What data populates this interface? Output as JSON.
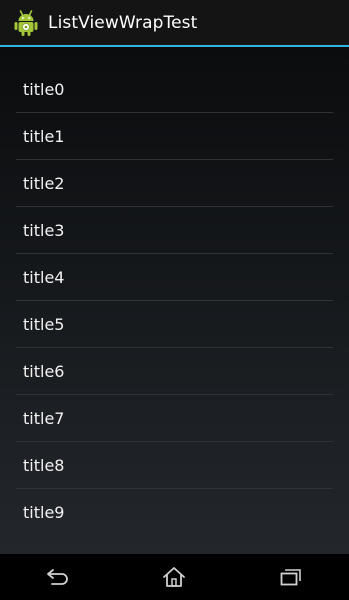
{
  "action_bar": {
    "title": "ListViewWrapTest",
    "icon": "android-robot-icon"
  },
  "list": {
    "items": [
      {
        "title": "title0"
      },
      {
        "title": "title1"
      },
      {
        "title": "title2"
      },
      {
        "title": "title3"
      },
      {
        "title": "title4"
      },
      {
        "title": "title5"
      },
      {
        "title": "title6"
      },
      {
        "title": "title7"
      },
      {
        "title": "title8"
      },
      {
        "title": "title9"
      }
    ]
  },
  "nav_bar": {
    "buttons": [
      {
        "name": "back-icon"
      },
      {
        "name": "home-icon"
      },
      {
        "name": "recent-apps-icon"
      }
    ]
  },
  "colors": {
    "accent": "#33b5e5",
    "android_green": "#a4c639",
    "background": "#000000",
    "text": "#ffffff"
  }
}
